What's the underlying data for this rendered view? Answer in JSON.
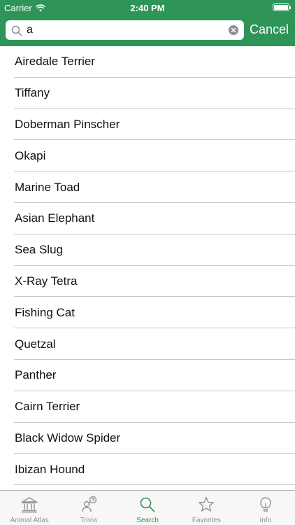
{
  "status_bar": {
    "carrier": "Carrier",
    "time": "2:40 PM"
  },
  "search": {
    "value": "a",
    "placeholder": "",
    "cancel_label": "Cancel"
  },
  "results": [
    "Airedale Terrier",
    "Tiffany",
    "Doberman Pinscher",
    "Okapi",
    "Marine Toad",
    "Asian Elephant",
    "Sea Slug",
    "X-Ray Tetra",
    "Fishing Cat",
    "Quetzal",
    "Panther",
    "Cairn Terrier",
    "Black Widow Spider",
    "Ibizan Hound"
  ],
  "tabs": [
    {
      "label": "Animal Atlas",
      "icon": "museum-icon",
      "active": false
    },
    {
      "label": "Trivia",
      "icon": "trivia-icon",
      "active": false
    },
    {
      "label": "Search",
      "icon": "search-icon",
      "active": true
    },
    {
      "label": "Favorites",
      "icon": "star-icon",
      "active": false
    },
    {
      "label": "Info",
      "icon": "lightbulb-icon",
      "active": false
    }
  ],
  "colors": {
    "header": "#2f9457",
    "accent": "#2f9457",
    "inactive_tab": "#929292"
  }
}
